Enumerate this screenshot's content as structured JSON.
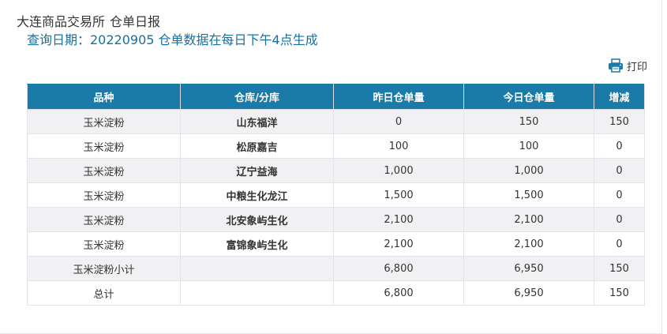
{
  "header": {
    "exchange": "大连商品交易所",
    "report": "仓单日报",
    "query_line": "查询日期：20220905 仓单数据在每日下午4点生成"
  },
  "toolbar": {
    "print_label": "打印",
    "print_icon": "printer-icon"
  },
  "table": {
    "columns": [
      "品种",
      "仓库/分库",
      "昨日仓单量",
      "今日仓单量",
      "增减"
    ],
    "rows": [
      [
        "玉米淀粉",
        "山东福洋",
        "0",
        "150",
        "150"
      ],
      [
        "玉米淀粉",
        "松原嘉吉",
        "100",
        "100",
        "0"
      ],
      [
        "玉米淀粉",
        "辽宁益海",
        "1,000",
        "1,000",
        "0"
      ],
      [
        "玉米淀粉",
        "中粮生化龙江",
        "1,500",
        "1,500",
        "0"
      ],
      [
        "玉米淀粉",
        "北安象屿生化",
        "2,100",
        "2,100",
        "0"
      ],
      [
        "玉米淀粉",
        "富锦象屿生化",
        "2,100",
        "2,100",
        "0"
      ],
      [
        "玉米淀粉小计",
        "",
        "6,800",
        "6,950",
        "150"
      ],
      [
        "总计",
        "",
        "6,800",
        "6,950",
        "150"
      ]
    ]
  },
  "colors": {
    "header_bg": "#1a7aa8",
    "query_text": "#1670a0",
    "stripe": "#f1f1f3"
  }
}
